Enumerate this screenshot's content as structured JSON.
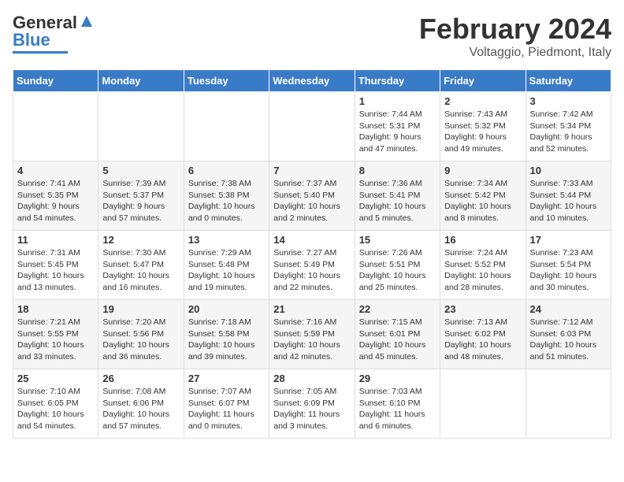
{
  "header": {
    "logo_line1": "General",
    "logo_line2": "Blue",
    "month_year": "February 2024",
    "location": "Voltaggio, Piedmont, Italy"
  },
  "weekdays": [
    "Sunday",
    "Monday",
    "Tuesday",
    "Wednesday",
    "Thursday",
    "Friday",
    "Saturday"
  ],
  "weeks": [
    [
      {
        "day": "",
        "info": ""
      },
      {
        "day": "",
        "info": ""
      },
      {
        "day": "",
        "info": ""
      },
      {
        "day": "",
        "info": ""
      },
      {
        "day": "1",
        "info": "Sunrise: 7:44 AM\nSunset: 5:31 PM\nDaylight: 9 hours\nand 47 minutes."
      },
      {
        "day": "2",
        "info": "Sunrise: 7:43 AM\nSunset: 5:32 PM\nDaylight: 9 hours\nand 49 minutes."
      },
      {
        "day": "3",
        "info": "Sunrise: 7:42 AM\nSunset: 5:34 PM\nDaylight: 9 hours\nand 52 minutes."
      }
    ],
    [
      {
        "day": "4",
        "info": "Sunrise: 7:41 AM\nSunset: 5:35 PM\nDaylight: 9 hours\nand 54 minutes."
      },
      {
        "day": "5",
        "info": "Sunrise: 7:39 AM\nSunset: 5:37 PM\nDaylight: 9 hours\nand 57 minutes."
      },
      {
        "day": "6",
        "info": "Sunrise: 7:38 AM\nSunset: 5:38 PM\nDaylight: 10 hours\nand 0 minutes."
      },
      {
        "day": "7",
        "info": "Sunrise: 7:37 AM\nSunset: 5:40 PM\nDaylight: 10 hours\nand 2 minutes."
      },
      {
        "day": "8",
        "info": "Sunrise: 7:36 AM\nSunset: 5:41 PM\nDaylight: 10 hours\nand 5 minutes."
      },
      {
        "day": "9",
        "info": "Sunrise: 7:34 AM\nSunset: 5:42 PM\nDaylight: 10 hours\nand 8 minutes."
      },
      {
        "day": "10",
        "info": "Sunrise: 7:33 AM\nSunset: 5:44 PM\nDaylight: 10 hours\nand 10 minutes."
      }
    ],
    [
      {
        "day": "11",
        "info": "Sunrise: 7:31 AM\nSunset: 5:45 PM\nDaylight: 10 hours\nand 13 minutes."
      },
      {
        "day": "12",
        "info": "Sunrise: 7:30 AM\nSunset: 5:47 PM\nDaylight: 10 hours\nand 16 minutes."
      },
      {
        "day": "13",
        "info": "Sunrise: 7:29 AM\nSunset: 5:48 PM\nDaylight: 10 hours\nand 19 minutes."
      },
      {
        "day": "14",
        "info": "Sunrise: 7:27 AM\nSunset: 5:49 PM\nDaylight: 10 hours\nand 22 minutes."
      },
      {
        "day": "15",
        "info": "Sunrise: 7:26 AM\nSunset: 5:51 PM\nDaylight: 10 hours\nand 25 minutes."
      },
      {
        "day": "16",
        "info": "Sunrise: 7:24 AM\nSunset: 5:52 PM\nDaylight: 10 hours\nand 28 minutes."
      },
      {
        "day": "17",
        "info": "Sunrise: 7:23 AM\nSunset: 5:54 PM\nDaylight: 10 hours\nand 30 minutes."
      }
    ],
    [
      {
        "day": "18",
        "info": "Sunrise: 7:21 AM\nSunset: 5:55 PM\nDaylight: 10 hours\nand 33 minutes."
      },
      {
        "day": "19",
        "info": "Sunrise: 7:20 AM\nSunset: 5:56 PM\nDaylight: 10 hours\nand 36 minutes."
      },
      {
        "day": "20",
        "info": "Sunrise: 7:18 AM\nSunset: 5:58 PM\nDaylight: 10 hours\nand 39 minutes."
      },
      {
        "day": "21",
        "info": "Sunrise: 7:16 AM\nSunset: 5:59 PM\nDaylight: 10 hours\nand 42 minutes."
      },
      {
        "day": "22",
        "info": "Sunrise: 7:15 AM\nSunset: 6:01 PM\nDaylight: 10 hours\nand 45 minutes."
      },
      {
        "day": "23",
        "info": "Sunrise: 7:13 AM\nSunset: 6:02 PM\nDaylight: 10 hours\nand 48 minutes."
      },
      {
        "day": "24",
        "info": "Sunrise: 7:12 AM\nSunset: 6:03 PM\nDaylight: 10 hours\nand 51 minutes."
      }
    ],
    [
      {
        "day": "25",
        "info": "Sunrise: 7:10 AM\nSunset: 6:05 PM\nDaylight: 10 hours\nand 54 minutes."
      },
      {
        "day": "26",
        "info": "Sunrise: 7:08 AM\nSunset: 6:06 PM\nDaylight: 10 hours\nand 57 minutes."
      },
      {
        "day": "27",
        "info": "Sunrise: 7:07 AM\nSunset: 6:07 PM\nDaylight: 11 hours\nand 0 minutes."
      },
      {
        "day": "28",
        "info": "Sunrise: 7:05 AM\nSunset: 6:09 PM\nDaylight: 11 hours\nand 3 minutes."
      },
      {
        "day": "29",
        "info": "Sunrise: 7:03 AM\nSunset: 6:10 PM\nDaylight: 11 hours\nand 6 minutes."
      },
      {
        "day": "",
        "info": ""
      },
      {
        "day": "",
        "info": ""
      }
    ]
  ]
}
